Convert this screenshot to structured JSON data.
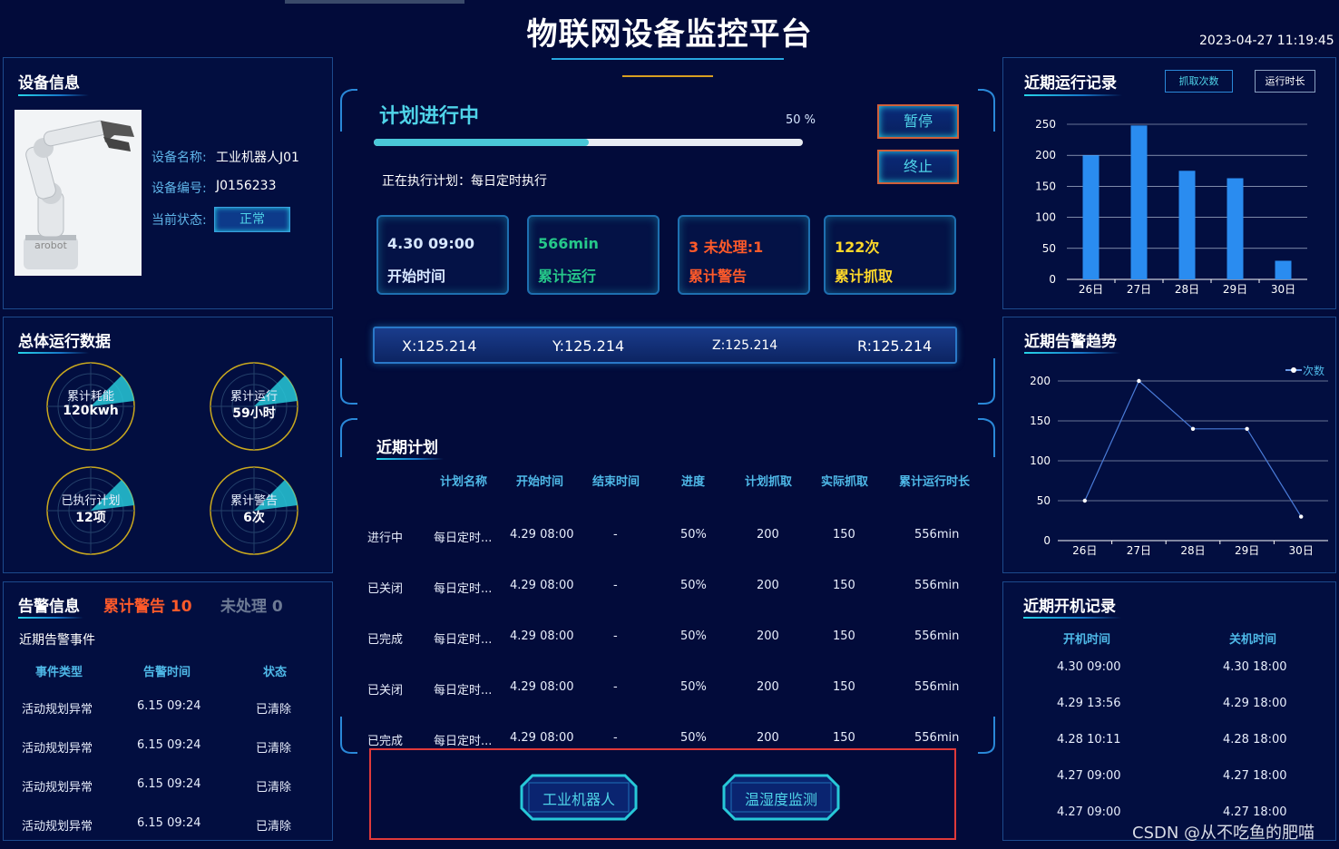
{
  "header": {
    "title": "物联网设备监控平台",
    "datetime": "2023-04-27 11:19:45"
  },
  "device": {
    "title": "设备信息",
    "name_label": "设备名称:",
    "name_value": "工业机器人J01",
    "id_label": "设备编号:",
    "id_value": "J0156233",
    "status_label": "当前状态:",
    "status_value": "正常",
    "image_text": "arobot"
  },
  "overall": {
    "title": "总体运行数据",
    "gauges": [
      {
        "label": "累计耗能",
        "value": "120kwh"
      },
      {
        "label": "累计运行",
        "value": "59小时"
      },
      {
        "label": "已执行计划",
        "value": "12项"
      },
      {
        "label": "累计警告",
        "value": "6次"
      }
    ]
  },
  "alarm": {
    "tab_info": "告警信息",
    "tab_total": "累计警告 10",
    "tab_pending": "未处理 0",
    "subtitle": "近期告警事件",
    "columns": [
      "事件类型",
      "告警时间",
      "状态"
    ],
    "rows": [
      [
        "活动规划异常",
        "6.15 09:24",
        "已清除"
      ],
      [
        "活动规划异常",
        "6.15 09:24",
        "已清除"
      ],
      [
        "活动规划异常",
        "6.15 09:24",
        "已清除"
      ],
      [
        "活动规划异常",
        "6.15 09:24",
        "已清除"
      ]
    ]
  },
  "plan": {
    "title": "计划进行中",
    "progress_label": "50 %",
    "progress": 0.5,
    "executing": "正在执行计划：每日定时执行",
    "pause_button": "暂停",
    "stop_button": "终止",
    "cards": [
      {
        "value": "4.30 09:00",
        "label": "开始时间",
        "color": "#d6e6ff"
      },
      {
        "value": "566min",
        "label": "累计运行",
        "color": "#26c88a"
      },
      {
        "value": "3 未处理:1",
        "label": "累计警告",
        "color": "#ff5a2a"
      },
      {
        "value": "122次",
        "label": "累计抓取",
        "color": "#ffd82a"
      }
    ],
    "coords": {
      "x": "X:125.214",
      "y": "Y:125.214",
      "z": "Z:125.214",
      "r": "R:125.214"
    }
  },
  "recent_plans": {
    "title": "近期计划",
    "columns": [
      "计划名称",
      "开始时间",
      "结束时间",
      "进度",
      "计划抓取",
      "实际抓取",
      "累计运行时长"
    ],
    "rows": [
      [
        "进行中",
        "每日定时...",
        "4.29 08:00",
        "-",
        "50%",
        "200",
        "150",
        "556min"
      ],
      [
        "已关闭",
        "每日定时...",
        "4.29 08:00",
        "-",
        "50%",
        "200",
        "150",
        "556min"
      ],
      [
        "已完成",
        "每日定时...",
        "4.29 08:00",
        "-",
        "50%",
        "200",
        "150",
        "556min"
      ],
      [
        "已关闭",
        "每日定时...",
        "4.29 08:00",
        "-",
        "50%",
        "200",
        "150",
        "556min"
      ],
      [
        "已完成",
        "每日定时...",
        "4.29 08:00",
        "-",
        "50%",
        "200",
        "150",
        "556min"
      ]
    ]
  },
  "nav": {
    "robot_button": "工业机器人",
    "humidity_button": "温湿度监测"
  },
  "run_record": {
    "title": "近期运行记录",
    "tab_grab": "抓取次数",
    "tab_runtime": "运行时长",
    "chart_data": {
      "type": "bar",
      "categories": [
        "26日",
        "27日",
        "28日",
        "29日",
        "30日"
      ],
      "values": [
        200,
        248,
        175,
        163,
        30
      ],
      "yticks": [
        0,
        50,
        100,
        150,
        200,
        250
      ],
      "ylim": [
        0,
        250
      ],
      "color": "#2a8cf0"
    }
  },
  "alarm_trend": {
    "title": "近期告警趋势",
    "legend": "次数",
    "chart_data": {
      "type": "line",
      "categories": [
        "26日",
        "27日",
        "28日",
        "29日",
        "30日"
      ],
      "values": [
        50,
        200,
        140,
        140,
        30
      ],
      "yticks": [
        0,
        50,
        100,
        150,
        200
      ],
      "ylim": [
        0,
        200
      ],
      "color": "#4a7bd8"
    }
  },
  "power_record": {
    "title": "近期开机记录",
    "columns": [
      "开机时间",
      "关机时间"
    ],
    "rows": [
      [
        "4.30 09:00",
        "4.30 18:00"
      ],
      [
        "4.29 13:56",
        "4.29 18:00"
      ],
      [
        "4.28 10:11",
        "4.28 18:00"
      ],
      [
        "4.27 09:00",
        "4.27 18:00"
      ],
      [
        "4.27 09:00",
        "4.27 18:00"
      ]
    ]
  },
  "watermark": "CSDN @从不吃鱼的肥喵"
}
